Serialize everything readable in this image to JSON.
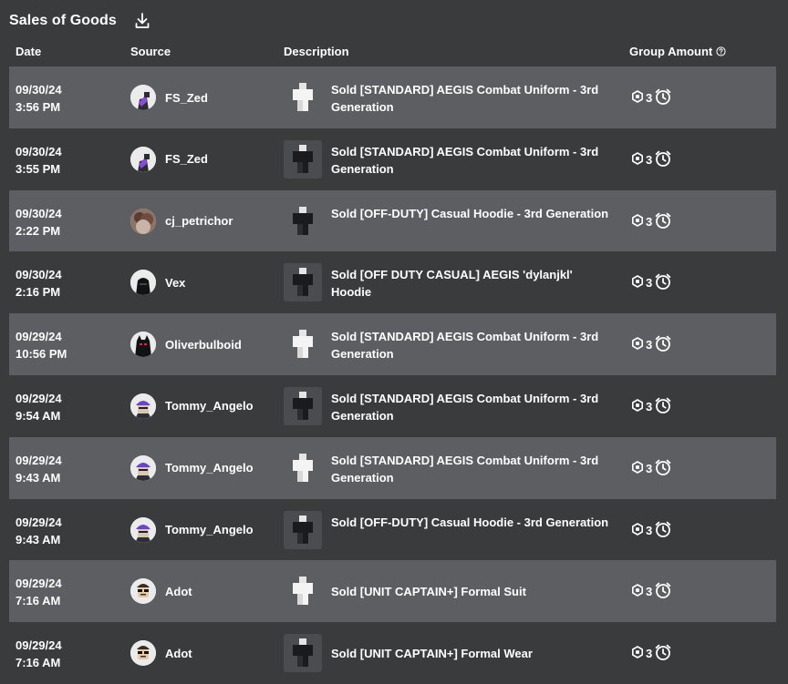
{
  "title": "Sales of Goods",
  "columns": {
    "date": "Date",
    "source": "Source",
    "description": "Description",
    "amount": "Group Amount"
  },
  "rows": [
    {
      "date": "09/30/24",
      "time": "3:56 PM",
      "user": "FS_Zed",
      "item": "Sold [STANDARD] AEGIS Combat Uniform - 3rd Generation",
      "amount": "3",
      "avatar": "purple",
      "thumb": "white"
    },
    {
      "date": "09/30/24",
      "time": "3:55 PM",
      "user": "FS_Zed",
      "item": "Sold [STANDARD] AEGIS Combat Uniform - 3rd Generation",
      "amount": "3",
      "avatar": "purple",
      "thumb": "black"
    },
    {
      "date": "09/30/24",
      "time": "2:22 PM",
      "user": "cj_petrichor",
      "item": "Sold [OFF-DUTY] Casual Hoodie - 3rd Generation",
      "amount": "3",
      "avatar": "brown",
      "thumb": "black"
    },
    {
      "date": "09/30/24",
      "time": "2:16 PM",
      "user": "Vex",
      "item": "Sold [OFF DUTY CASUAL] AEGIS 'dylanjkl' Hoodie",
      "amount": "3",
      "avatar": "black",
      "thumb": "black"
    },
    {
      "date": "09/29/24",
      "time": "10:56 PM",
      "user": "Oliverbulboid",
      "item": "Sold [STANDARD] AEGIS Combat Uniform - 3rd Generation",
      "amount": "3",
      "avatar": "red",
      "thumb": "white"
    },
    {
      "date": "09/29/24",
      "time": "9:54 AM",
      "user": "Tommy_Angelo",
      "item": "Sold [STANDARD] AEGIS Combat Uniform - 3rd Generation",
      "amount": "3",
      "avatar": "violet",
      "thumb": "black"
    },
    {
      "date": "09/29/24",
      "time": "9:43 AM",
      "user": "Tommy_Angelo",
      "item": "Sold [STANDARD] AEGIS Combat Uniform - 3rd Generation",
      "amount": "3",
      "avatar": "violet",
      "thumb": "white"
    },
    {
      "date": "09/29/24",
      "time": "9:43 AM",
      "user": "Tommy_Angelo",
      "item": "Sold [OFF-DUTY] Casual Hoodie - 3rd Generation",
      "amount": "3",
      "avatar": "violet",
      "thumb": "black"
    },
    {
      "date": "09/29/24",
      "time": "7:16 AM",
      "user": "Adot",
      "item": "Sold [UNIT CAPTAIN+] Formal Suit",
      "amount": "3",
      "avatar": "glasses",
      "thumb": "white"
    },
    {
      "date": "09/29/24",
      "time": "7:16 AM",
      "user": "Adot",
      "item": "Sold [UNIT CAPTAIN+] Formal Wear",
      "amount": "3",
      "avatar": "glasses",
      "thumb": "black"
    }
  ],
  "icons": {
    "download": "download-icon",
    "help": "help-circle-icon",
    "currency": "robux-icon",
    "pending": "pending-clock-icon"
  },
  "colors": {
    "background": "#393b3d",
    "row_alt": "#5c5e62",
    "text": "#ffffff"
  }
}
